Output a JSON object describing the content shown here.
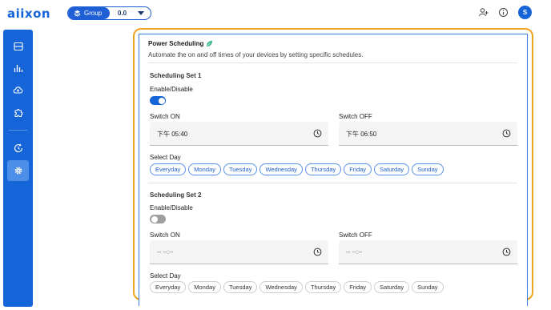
{
  "header": {
    "logo_text": "aiixon",
    "group_label": "Group",
    "group_version": "0.0",
    "avatar_letter": "S"
  },
  "sidebar": {
    "items": [
      {
        "icon": "storage-icon"
      },
      {
        "icon": "bar-chart-icon"
      },
      {
        "icon": "cloud-upload-icon"
      },
      {
        "icon": "puzzle-icon"
      },
      {
        "icon": "refresh-clock-icon"
      },
      {
        "icon": "gear-icon",
        "active": true
      }
    ]
  },
  "panel": {
    "title": "Power Scheduling",
    "description": "Automate the on and off times of your devices by setting specific schedules.",
    "sets": [
      {
        "title": "Scheduling Set 1",
        "enable_label": "Enable/Disable",
        "enabled": true,
        "switch_on_label": "Switch ON",
        "switch_on_value": "下午 05:40",
        "switch_off_label": "Switch OFF",
        "switch_off_value": "下午 06:50",
        "select_day_label": "Select Day",
        "days": [
          "Everyday",
          "Monday",
          "Tuesday",
          "Wednesday",
          "Thursday",
          "Friday",
          "Saturday",
          "Sunday"
        ],
        "days_selected": true
      },
      {
        "title": "Scheduling Set 2",
        "enable_label": "Enable/Disable",
        "enabled": false,
        "switch_on_label": "Switch ON",
        "switch_on_value": "-- --:--",
        "switch_off_label": "Switch OFF",
        "switch_off_value": "-- --:--",
        "select_day_label": "Select Day",
        "days": [
          "Everyday",
          "Monday",
          "Tuesday",
          "Wednesday",
          "Thursday",
          "Friday",
          "Saturday",
          "Sunday"
        ],
        "days_selected": false
      }
    ]
  },
  "colors": {
    "brand": "#1565d8",
    "highlight": "#f0a31f",
    "leaf": "#3dba8c"
  }
}
